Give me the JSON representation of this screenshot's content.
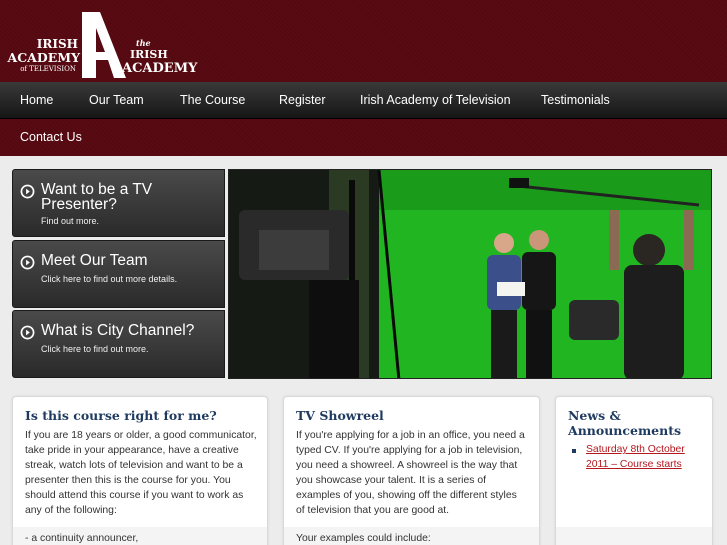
{
  "header": {
    "logo_left": [
      "IRISH",
      "ACADEMY",
      "of TELEVISION"
    ],
    "logo_right": [
      "the",
      "IRISH",
      "ACADEMY"
    ]
  },
  "nav": {
    "items": [
      "Home",
      "Our Team",
      "The Course",
      "Register",
      "Irish Academy of Television",
      "Testimonials",
      "Contact Us"
    ]
  },
  "tabs": [
    {
      "title": "Want to be a TV Presenter?",
      "sub": "Find out more."
    },
    {
      "title": "Meet Our Team",
      "sub": "Click here to find out more details."
    },
    {
      "title": "What is City Channel?",
      "sub": "Click here to find out more."
    }
  ],
  "boxes": {
    "course": {
      "title": "Is this course right for me?",
      "text": "If you are 18 years or older, a good communicator, take pride in your appearance, have a creative streak, watch lots of television and want to be a presenter then this is the course for you. You should attend this course if you want to work as any of the following:",
      "text2": "- a continuity announcer,"
    },
    "showreel": {
      "title": "TV Showreel",
      "text": "If you're applying for a job in an office, you need a typed CV. If you're applying for a job in television, you need a showreel. A showreel is the way that you showcase your talent. It is a series of examples of you, showing off the different styles of television that you are good at.",
      "text2": "Your examples could include:"
    },
    "news": {
      "title": "News & Announcements",
      "items": [
        "Saturday 8th October 2011 – Course starts"
      ]
    }
  },
  "colors": {
    "brand": "#5a0a12",
    "heading": "#1f3a5f",
    "link": "#b3181f",
    "greenscreen": "#1fb81f"
  }
}
